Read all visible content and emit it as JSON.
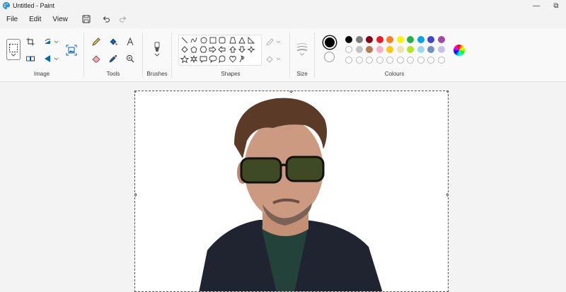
{
  "window": {
    "title": "Untitled - Paint",
    "minimize_glyph": "—",
    "restore_glyph": "⧉"
  },
  "menu": {
    "file": "File",
    "edit": "Edit",
    "view": "View"
  },
  "ribbon": {
    "groups": {
      "image": "Image",
      "tools": "Tools",
      "brushes": "Brushes",
      "shapes": "Shapes",
      "size": "Size",
      "colours": "Colours"
    }
  },
  "colors": {
    "accent": "#0067c0",
    "primary": "#000000",
    "secondary": "#ffffff",
    "palette_row1": [
      "#000000",
      "#7f7f7f",
      "#880015",
      "#ed1c24",
      "#ff7f27",
      "#fff200",
      "#22b14c",
      "#00a2e8",
      "#3f48cc",
      "#a349a4"
    ],
    "palette_row2": [
      "#ffffff",
      "#c3c3c3",
      "#b97a57",
      "#ffaec9",
      "#ffc90e",
      "#efe4b0",
      "#b5e61d",
      "#99d9ea",
      "#7092be",
      "#c8bfe7"
    ],
    "palette_row3_count": 10
  },
  "icons": {
    "app": "paint-palette-icon",
    "save": "floppy-disk-icon",
    "undo": "undo-icon",
    "redo": "redo-icon",
    "selection": "selection-rectangle-icon",
    "crop": "crop-icon",
    "resize": "resize-icon",
    "rotate": "rotate-icon",
    "flip": "flip-icon",
    "image_creator": "image-creator-icon",
    "pencil": "pencil-icon",
    "fill": "fill-bucket-icon",
    "text": "text-icon",
    "eraser": "eraser-icon",
    "color_picker": "color-picker-icon",
    "magnifier": "magnifier-icon",
    "brush": "brush-icon",
    "outline": "shape-outline-icon",
    "shape_fill": "shape-fill-icon",
    "size": "line-size-icon",
    "edit_colors": "edit-colors-icon"
  },
  "canvas": {
    "image_subject": "portrait-photo"
  }
}
